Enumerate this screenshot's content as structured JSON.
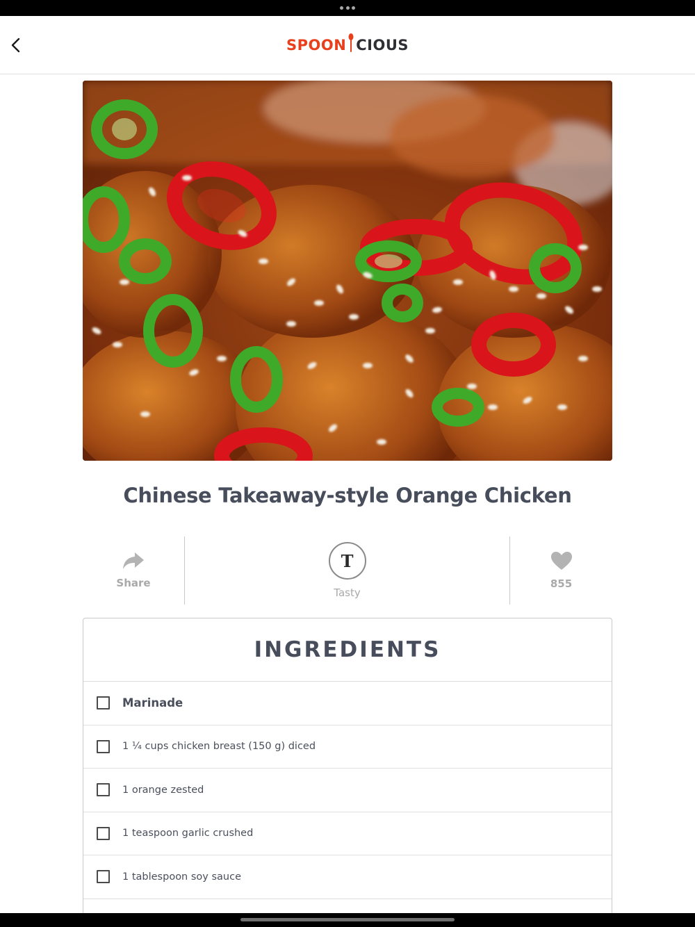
{
  "app": {
    "logo_left": "SPOON",
    "logo_right": "CIOUS",
    "brand_color": "#e8401c"
  },
  "nav": {
    "back_icon": "chevron-left-icon"
  },
  "recipe": {
    "title": "Chinese Takeaway-style Orange Chicken",
    "share_label": "Share",
    "author_initial": "T",
    "author_name": "Tasty",
    "like_count": "855"
  },
  "ingredients": {
    "heading": "INGREDIENTS",
    "items": [
      {
        "text": "Marinade",
        "section": true
      },
      {
        "text": "1 ¼ cups chicken breast (150 g) diced",
        "section": false
      },
      {
        "text": "1 orange zested",
        "section": false
      },
      {
        "text": "1 teaspoon garlic crushed",
        "section": false
      },
      {
        "text": "1 tablespoon soy sauce",
        "section": false
      }
    ]
  }
}
